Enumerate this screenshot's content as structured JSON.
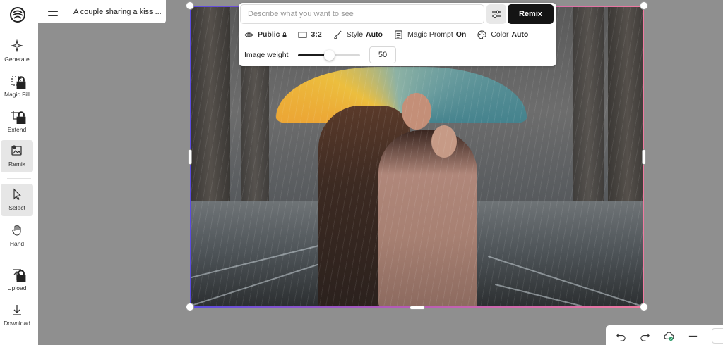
{
  "header": {
    "title": "A couple sharing a kiss ..."
  },
  "sidebar": {
    "items": [
      {
        "label": "Generate",
        "icon": "sparkle-icon"
      },
      {
        "label": "Magic Fill",
        "icon": "magic-fill-icon"
      },
      {
        "label": "Extend",
        "icon": "crop-extend-icon"
      },
      {
        "label": "Remix",
        "icon": "remix-image-icon"
      },
      {
        "label": "Select",
        "icon": "cursor-arrow-icon"
      },
      {
        "label": "Hand",
        "icon": "hand-icon"
      },
      {
        "label": "Upload",
        "icon": "upload-icon"
      },
      {
        "label": "Download",
        "icon": "download-icon"
      }
    ]
  },
  "prompt_panel": {
    "placeholder": "Describe what you want to see",
    "remix_label": "Remix",
    "options": {
      "visibility": "Public",
      "ratio": "3:2",
      "style_label": "Style",
      "style_value": "Auto",
      "magic_label": "Magic Prompt",
      "magic_value": "On",
      "color_label": "Color",
      "color_value": "Auto"
    },
    "weight_label": "Image weight",
    "weight_value": "50"
  },
  "colors": {
    "accent_dark": "#141414",
    "frame_gradient_start": "#5b4de0",
    "frame_gradient_end": "#f07aa0"
  }
}
